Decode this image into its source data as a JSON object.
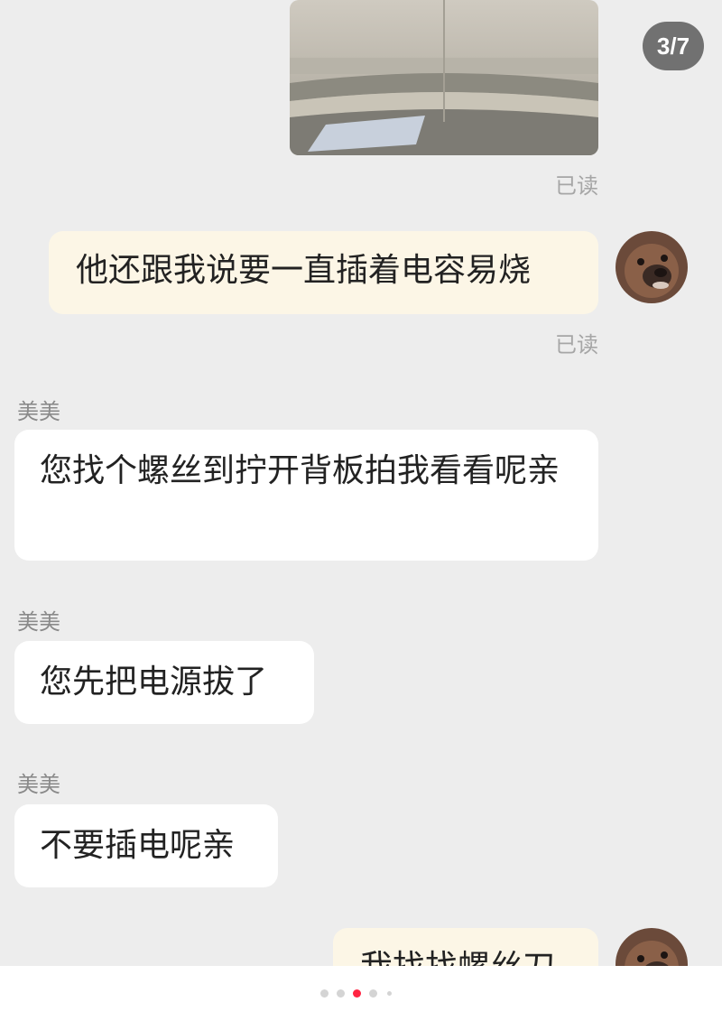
{
  "viewer": {
    "counter": "3/7",
    "page_dots": {
      "current": 3,
      "visible": 5
    },
    "accent_color": "#ff2442"
  },
  "messages": [
    {
      "type": "image",
      "from": "me",
      "status": "已读"
    },
    {
      "type": "text",
      "from": "me",
      "text": "他还跟我说要一直插着电容易烧",
      "status": "已读",
      "avatar": "dog-avatar"
    },
    {
      "type": "text",
      "from": "them",
      "sender": "美美",
      "text": "您找个螺丝到拧开背板拍我看看呢亲"
    },
    {
      "type": "text",
      "from": "them",
      "sender": "美美",
      "text": "您先把电源拔了"
    },
    {
      "type": "text",
      "from": "them",
      "sender": "美美",
      "text": "不要插电呢亲"
    },
    {
      "type": "text",
      "from": "me",
      "text": "我找找螺丝刀",
      "avatar": "dog-avatar",
      "partially_visible": true
    }
  ]
}
